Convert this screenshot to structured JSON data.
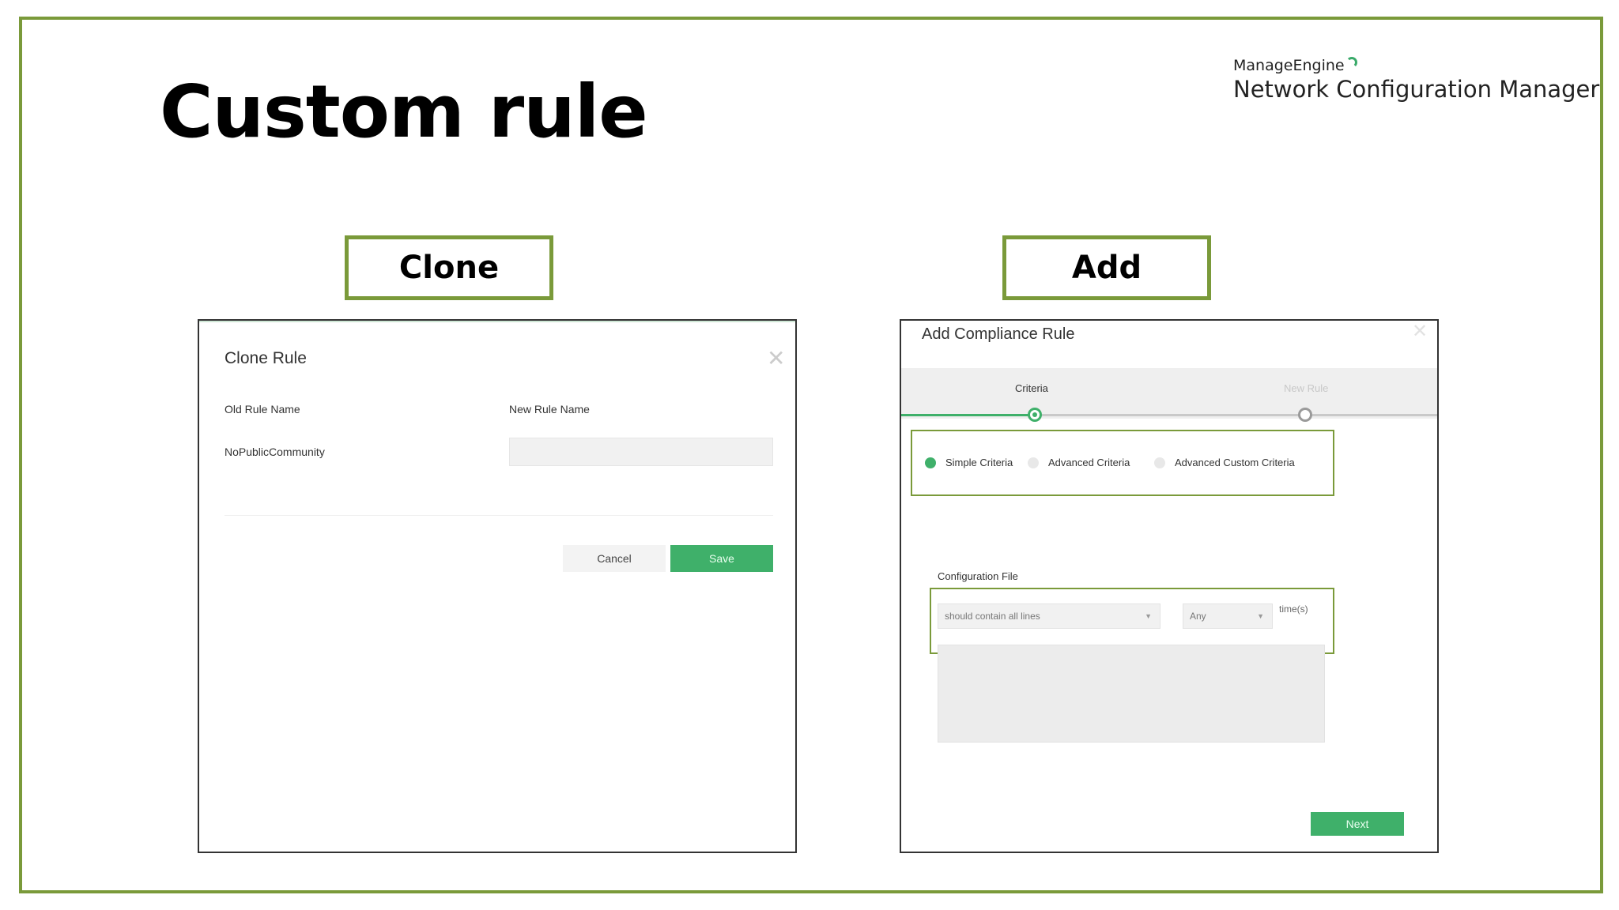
{
  "slide": {
    "title": "Custom rule",
    "brand_top": "ManageEngine",
    "brand_name": "Network Configuration Manager",
    "colors": {
      "frame": "#7a9a3a",
      "accent_green": "#3fb06a"
    }
  },
  "labels": {
    "clone": "Clone",
    "add": "Add"
  },
  "clone_dialog": {
    "title": "Clone Rule",
    "old_rule_label": "Old Rule Name",
    "new_rule_label": "New Rule Name",
    "old_rule_value": "NoPublicCommunity",
    "new_rule_value": "",
    "cancel_label": "Cancel",
    "save_label": "Save",
    "close_icon": "close-icon"
  },
  "add_dialog": {
    "title": "Add Compliance Rule",
    "steps": [
      "Criteria",
      "New Rule"
    ],
    "active_step": 0,
    "criteria_options": [
      "Simple Criteria",
      "Advanced Criteria",
      "Advanced Custom Criteria"
    ],
    "selected_criteria": "Simple Criteria",
    "config_label": "Configuration File",
    "condition_select": "should contain all lines",
    "count_select": "Any",
    "times_label": "time(s)",
    "next_label": "Next",
    "close_icon": "close-icon"
  }
}
